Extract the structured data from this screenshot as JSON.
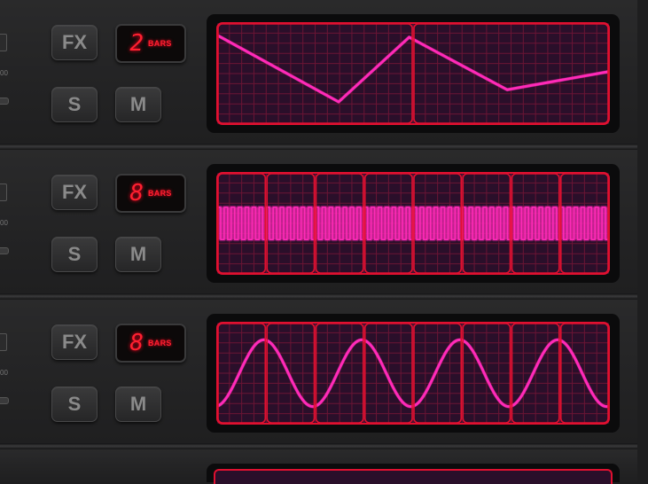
{
  "colors": {
    "screen_bg": "#2a0f2a",
    "grid": "#6a1535",
    "frame": "#e01030",
    "wave": "#ff2ab8",
    "lcd_text": "#ff2030"
  },
  "tracks": [
    {
      "fx_label": "FX",
      "solo_label": "S",
      "mute_label": "M",
      "bars_value": "2",
      "bars_unit": "BARS",
      "waveform": "lfo-triangle-icon",
      "segments": 2,
      "shape": "triangle",
      "cycles": 1
    },
    {
      "fx_label": "FX",
      "solo_label": "S",
      "mute_label": "M",
      "bars_value": "8",
      "bars_unit": "BARS",
      "waveform": "lfo-square-icon",
      "segments": 8,
      "shape": "square",
      "cycles": 56
    },
    {
      "fx_label": "FX",
      "solo_label": "S",
      "mute_label": "M",
      "bars_value": "8",
      "bars_unit": "BARS",
      "waveform": "lfo-sine-icon",
      "segments": 8,
      "shape": "sine",
      "cycles": 4
    }
  ],
  "edge_text": "00"
}
